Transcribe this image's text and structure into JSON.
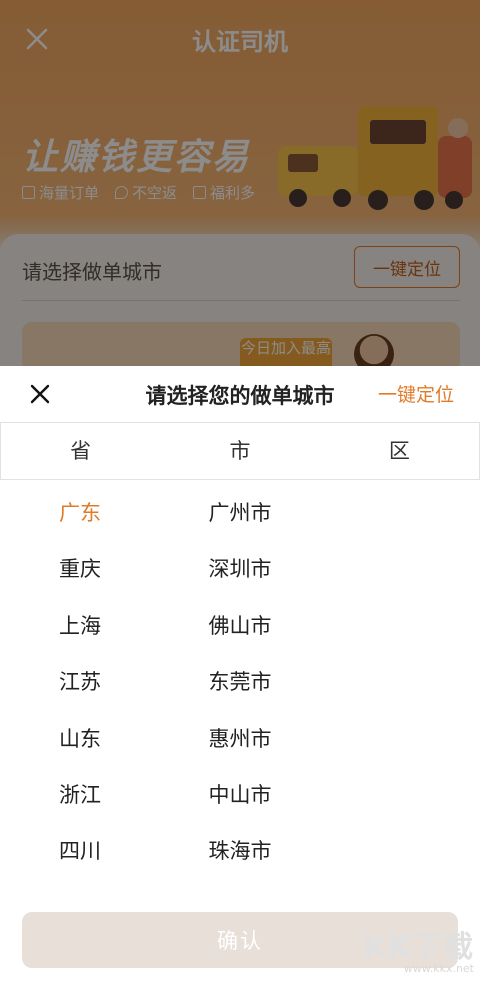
{
  "background": {
    "title": "认证司机",
    "slogan": "让赚钱更容易",
    "tags": [
      "海量订单",
      "不空返",
      "福利多"
    ],
    "city_label": "请选择做单城市",
    "locate_button": "一键定位",
    "promo_badge": "今日加入最高"
  },
  "sheet": {
    "title": "请选择您的做单城市",
    "locate_link": "一键定位",
    "columns": [
      "省",
      "市",
      "区"
    ],
    "provinces": [
      {
        "label": "广东",
        "selected": true
      },
      {
        "label": "重庆"
      },
      {
        "label": "上海"
      },
      {
        "label": "江苏"
      },
      {
        "label": "山东"
      },
      {
        "label": "浙江"
      },
      {
        "label": "四川"
      }
    ],
    "cities": [
      "广州市",
      "深圳市",
      "佛山市",
      "东莞市",
      "惠州市",
      "中山市",
      "珠海市"
    ],
    "confirm_button": "确认"
  },
  "watermark": {
    "logo": "KK下载",
    "url": "www.kkx.net"
  },
  "colors": {
    "accent": "#e07b2a",
    "banner": "#f4ad66",
    "confirm_disabled": "#e8dfd8"
  }
}
